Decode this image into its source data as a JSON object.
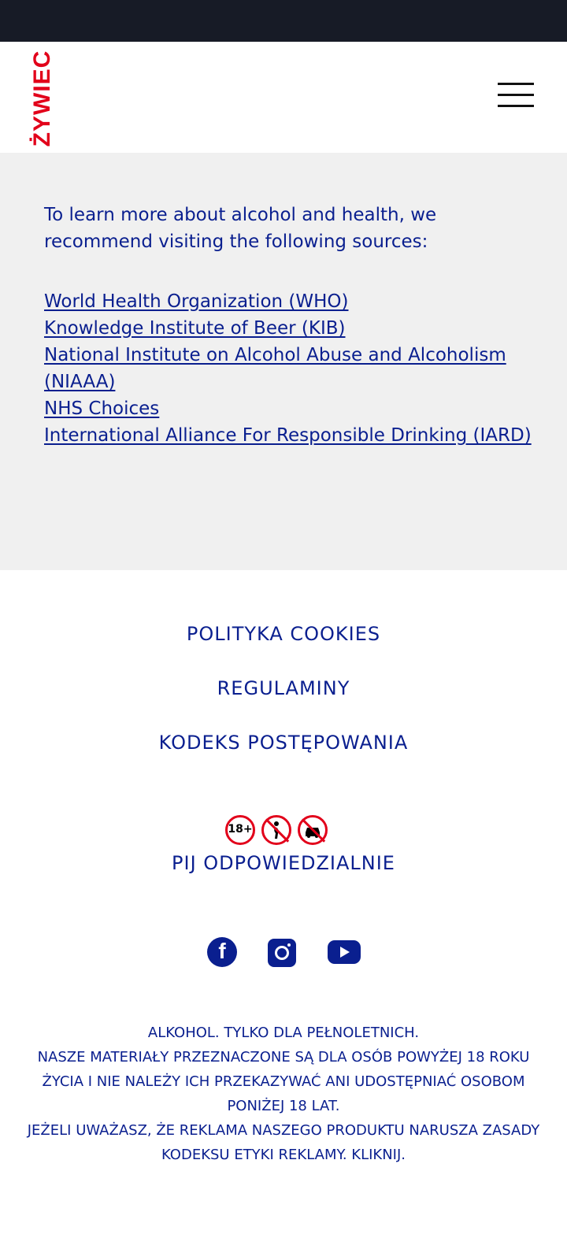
{
  "header": {
    "logo_text": "ŻYWIEC",
    "menu_icon": "hamburger-menu-icon"
  },
  "info": {
    "intro": "To learn more about alcohol and health, we recommend visiting the following sources:",
    "sources": [
      "World Health Organization (WHO)",
      "Knowledge Institute of Beer (KIB)",
      "National Institute on Alcohol Abuse and Alcoholism (NIAAA)",
      "NHS Choices",
      "International Alliance For Responsible Drinking (IARD)"
    ]
  },
  "footer": {
    "links": [
      "POLITYKA COOKIES",
      "REGULAMINY",
      "KODEKS POSTĘPOWANIA"
    ],
    "warning_icons": [
      "no-under-18-icon",
      "no-pregnant-icon",
      "no-drink-driving-icon"
    ],
    "age_label": "18+",
    "responsible": "PIJ ODPOWIEDZIALNIE",
    "social_icons": [
      "facebook-icon",
      "instagram-icon",
      "youtube-icon"
    ],
    "legal": [
      "ALKOHOL. TYLKO DLA PEŁNOLETNICH.",
      "NASZE MATERIAŁY PRZEZNACZONE SĄ DLA OSÓB POWYŻEJ 18 ROKU ŻYCIA I NIE NALEŻY ICH PRZEKAZYWAĆ ANI UDOSTĘPNIAĆ OSOBOM PONIŻEJ 18 LAT.",
      "JEŻELI UWAŻASZ, ŻE REKLAMA NASZEGO PRODUKTU NARUSZA ZASADY KODEKSU ETYKI REKLAMY. KLIKNIJ."
    ]
  },
  "colors": {
    "brand_red": "#e2001a",
    "text_blue": "#0a1f8f",
    "status_bar": "#171b26",
    "info_bg": "#f0f0f0"
  }
}
